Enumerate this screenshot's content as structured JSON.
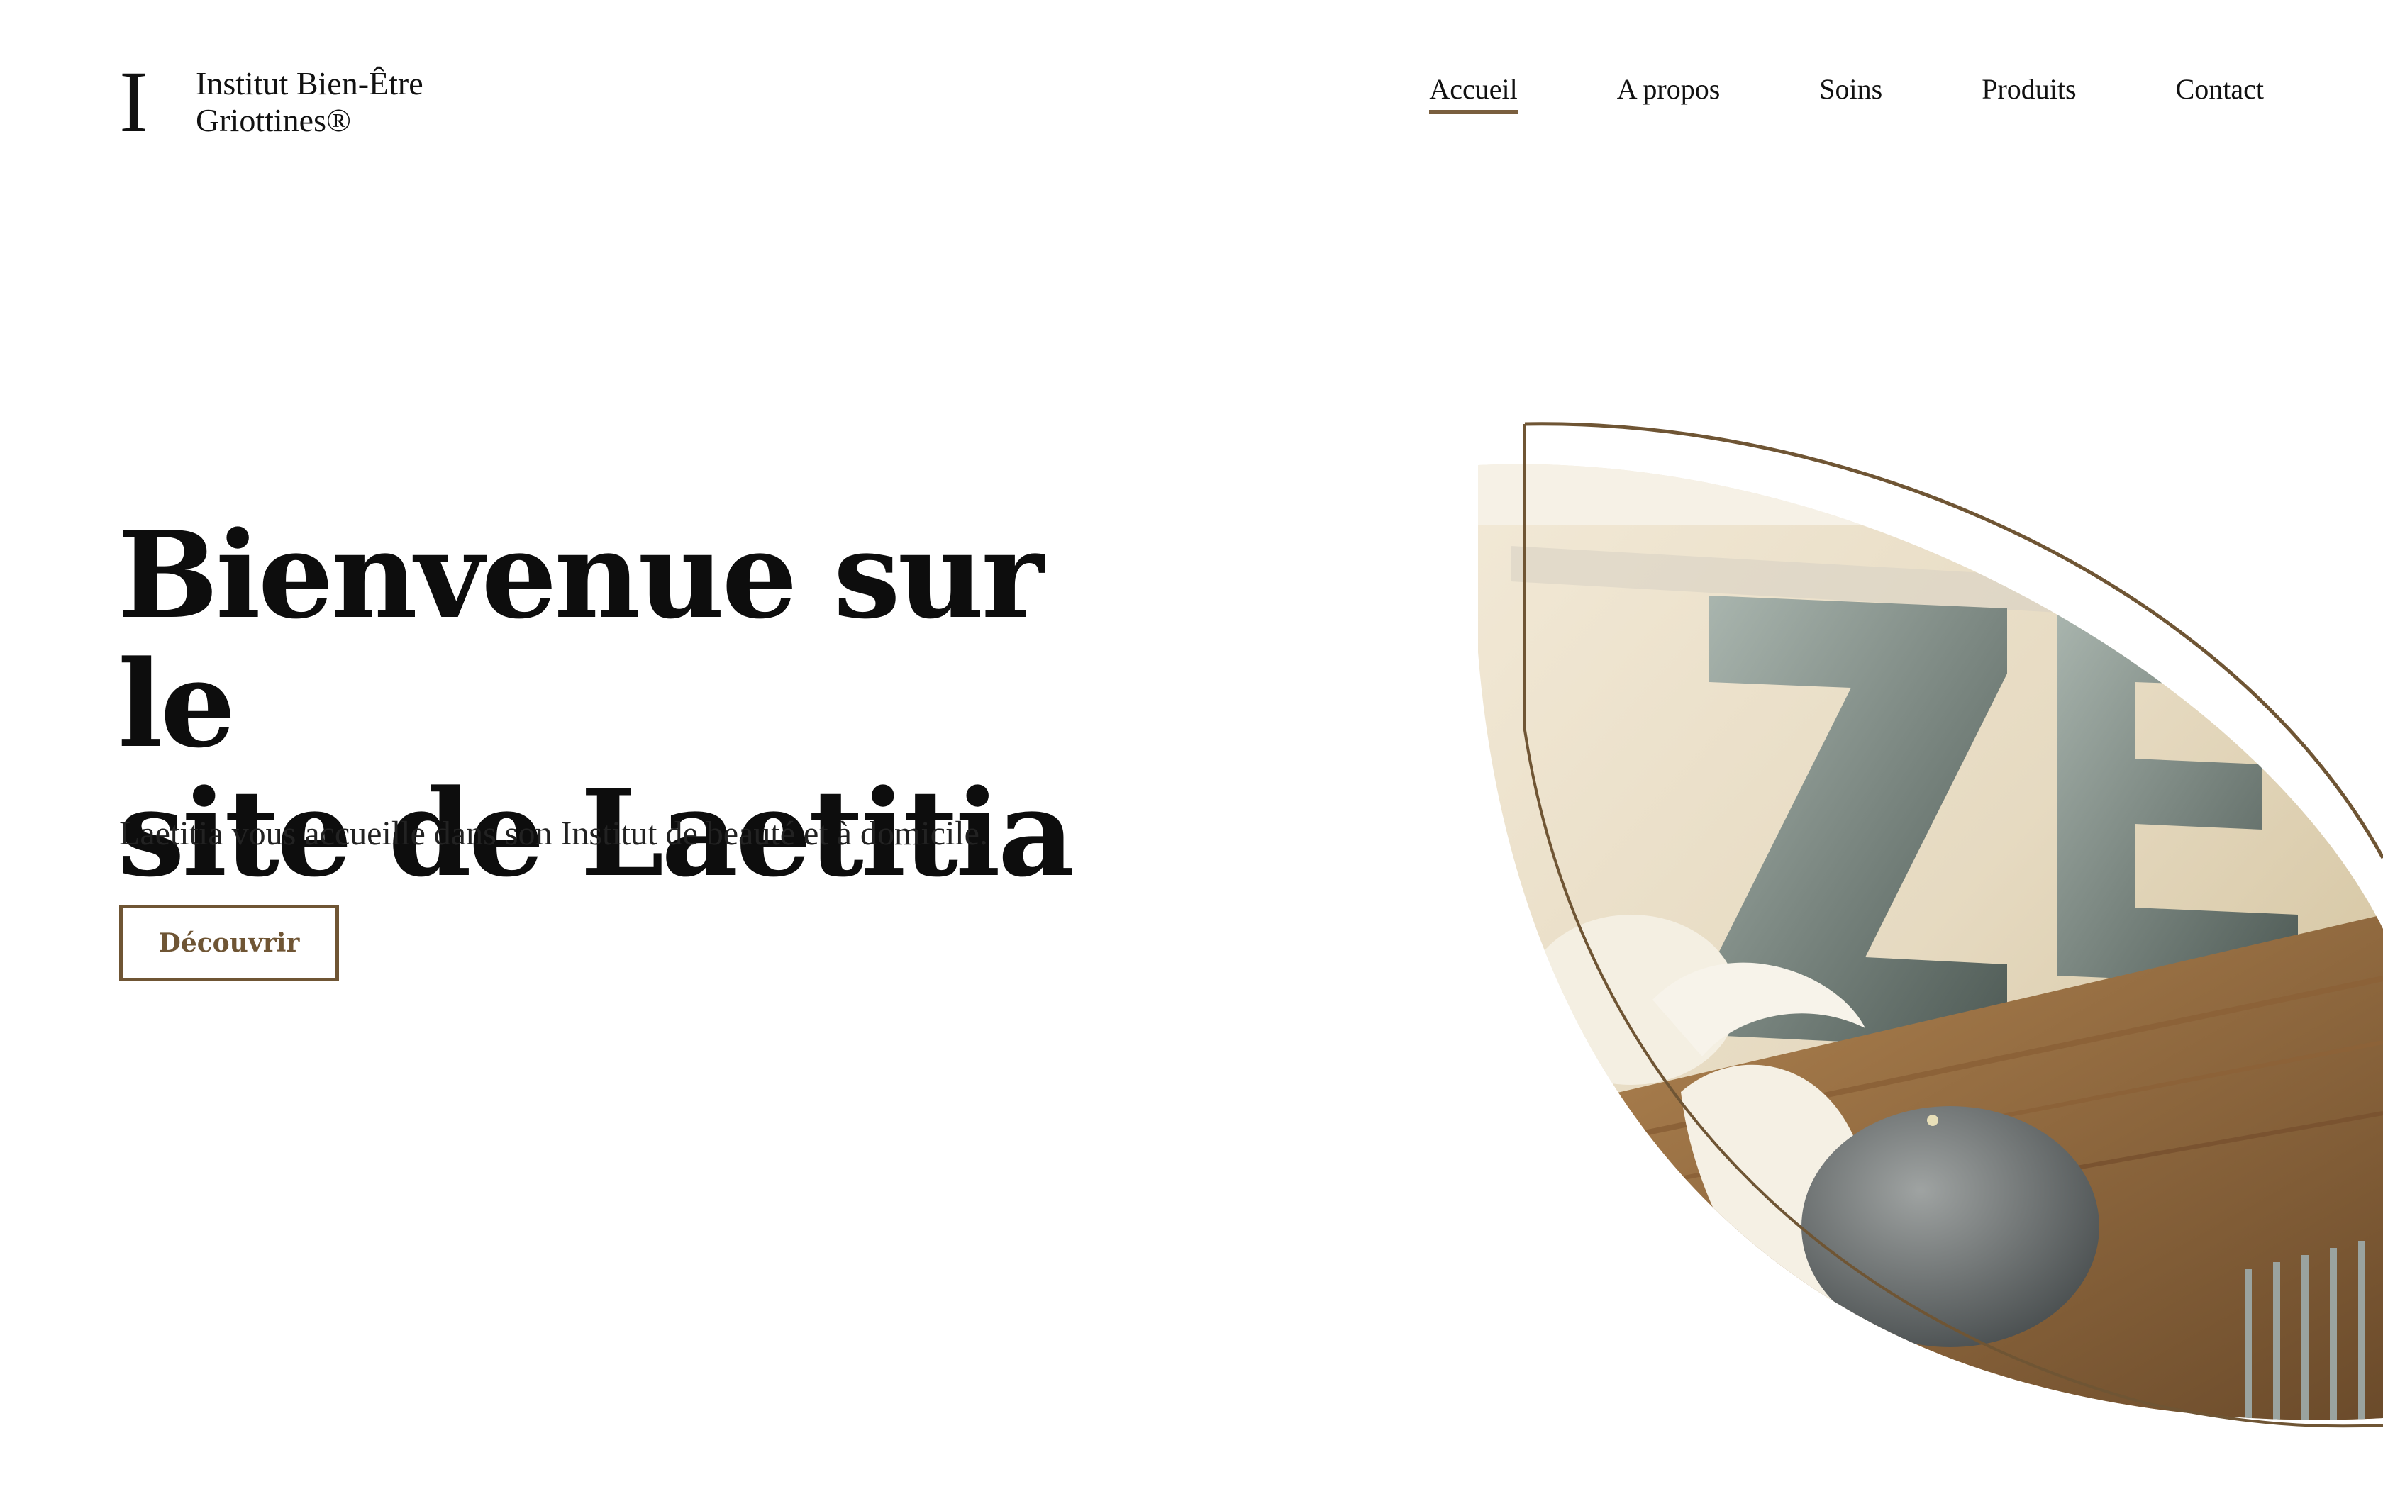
{
  "brand": {
    "mark": "I",
    "line1": "Institut Bien-Être",
    "line2": "Griottines®"
  },
  "nav": {
    "items": [
      {
        "label": "Accueil",
        "active": true
      },
      {
        "label": "A propos"
      },
      {
        "label": "Soins"
      },
      {
        "label": "Produits"
      },
      {
        "label": "Contact"
      }
    ]
  },
  "hero": {
    "title_line1": "Bienvenue sur le",
    "title_line2": "site de Laetitia",
    "subtitle": "Laetitia vous accueille dans son Institut de beauté et à domicile.",
    "cta_label": "Découvrir"
  },
  "image": {
    "letters": "ZE",
    "accent_color": "#6f5534"
  }
}
